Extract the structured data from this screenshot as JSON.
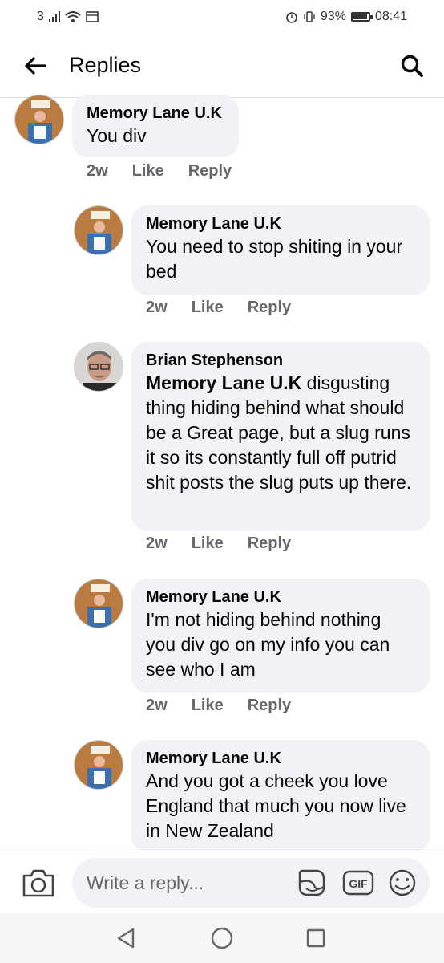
{
  "status_bar": {
    "sim": "3",
    "battery": "93%",
    "time": "08:41"
  },
  "header": {
    "title": "Replies"
  },
  "comments": [
    {
      "author": "Memory Lane U.K",
      "text": "You div",
      "time": "2w",
      "like": "Like",
      "reply": "Reply"
    },
    {
      "author": "Memory Lane U.K",
      "text": "You need to stop shiting in your bed",
      "time": "2w",
      "like": "Like",
      "reply": "Reply"
    },
    {
      "author": "Brian Stephenson",
      "mention": "Memory Lane U.K",
      "text": " disgusting thing hiding behind what should be a Great page, but a slug runs it so its constantly full off putrid shit posts the slug puts up there.",
      "time": "2w",
      "like": "Like",
      "reply": "Reply"
    },
    {
      "author": "Memory Lane U.K",
      "text": "I'm not hiding behind nothing you div go on my info you can see who I am",
      "time": "2w",
      "like": "Like",
      "reply": "Reply"
    },
    {
      "author": "Memory Lane U.K",
      "text": "And you got a cheek you love England that much you now live in New Zealand"
    }
  ],
  "reply_bar": {
    "placeholder": "Write a reply...",
    "gif_label": "GIF"
  },
  "icons": {
    "back": "back-arrow-icon",
    "search": "search-icon",
    "camera": "camera-icon",
    "sticker": "sticker-icon",
    "gif": "gif-icon",
    "emoji": "emoji-icon",
    "nav_back": "triangle-back-icon",
    "nav_home": "circle-home-icon",
    "nav_recents": "square-recents-icon"
  },
  "colors": {
    "bubble": "#f0f2f5",
    "meta_text": "#65676b",
    "nav_bar": "#f6f6f6"
  }
}
